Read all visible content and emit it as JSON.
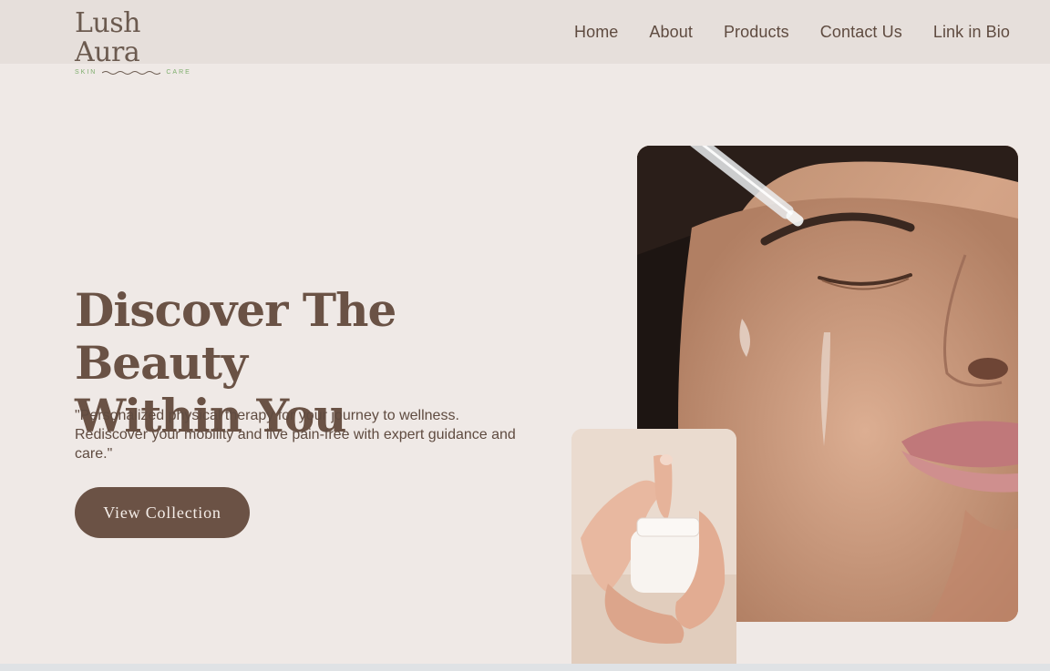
{
  "brand": {
    "name": "Lush Aura",
    "tagline_left": "SKIN",
    "tagline_right": "CARE"
  },
  "nav": {
    "items": [
      "Home",
      "About",
      "Products",
      "Contact Us",
      "Link in Bio"
    ]
  },
  "hero": {
    "title_line1": "Discover The Beauty",
    "title_line2": "Within You",
    "description": "\"Personalized physical therapy for your journey to wellness. Rediscover your mobility and live pain-free with expert guidance and care.\"",
    "cta_label": "View Collection"
  },
  "colors": {
    "page_bg": "#efe9e6",
    "header_bg": "#e6dfdb",
    "accent_brown": "#6b5245",
    "logo_green": "#7fae6e"
  }
}
